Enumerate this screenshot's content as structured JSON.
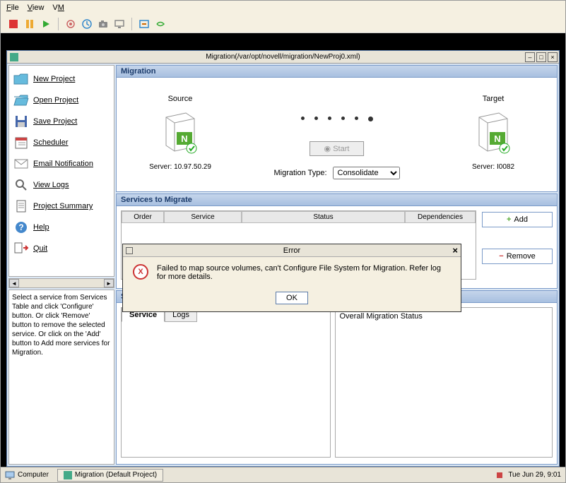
{
  "menu": {
    "file": "File",
    "view": "View",
    "vm": "VM"
  },
  "window": {
    "title": "Migration(/var/opt/novell/migration/NewProj0.xml)"
  },
  "sidebar": {
    "items": [
      {
        "label": "New Project"
      },
      {
        "label": "Open Project"
      },
      {
        "label": "Save Project"
      },
      {
        "label": "Scheduler"
      },
      {
        "label": "Email Notification"
      },
      {
        "label": "View Logs"
      },
      {
        "label": "Project Summary"
      },
      {
        "label": "Help"
      },
      {
        "label": "Quit"
      }
    ],
    "help_text": "Select a service from Services Table and click 'Configure' button. Or click 'Remove' button to remove the selected service. Or click on the 'Add' button to Add more services for Migration."
  },
  "migration": {
    "header": "Migration",
    "source_label": "Source",
    "target_label": "Target",
    "source_server": "Server: 10.97.50.29",
    "target_server": "Server: I0082",
    "start_label": "Start",
    "type_label": "Migration Type:",
    "type_value": "Consolidate"
  },
  "services": {
    "header": "Services to Migrate",
    "cols": {
      "order": "Order",
      "service": "Service",
      "status": "Status",
      "deps": "Dependencies"
    },
    "add_label": "Add",
    "remove_label": "Remove"
  },
  "status": {
    "header": "Status",
    "tab_service": "Service",
    "tab_logs": "Logs",
    "overall": "Overall Migration Status"
  },
  "dialog": {
    "title": "Error",
    "message": "Failed to map source volumes, can't Configure File System for Migration. Refer log for more details.",
    "ok": "OK"
  },
  "taskbar": {
    "computer": "Computer",
    "app": "Migration (Default Project)",
    "clock": "Tue Jun 29, 9:01"
  }
}
